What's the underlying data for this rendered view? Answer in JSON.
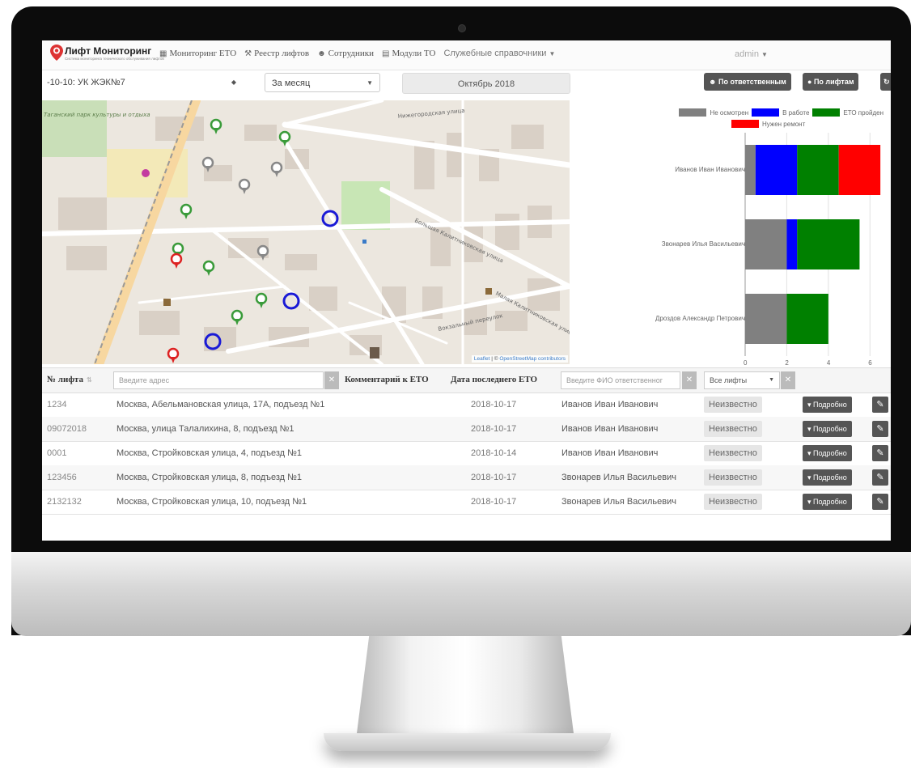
{
  "navbar": {
    "logo_title": "Лифт Мониторинг",
    "logo_subtitle": "Система мониторинга технического обслуживания лифтов",
    "items": [
      {
        "icon": "building-icon",
        "label": "Мониторинг ЕТО"
      },
      {
        "icon": "gavel-icon",
        "label": "Реестр лифтов"
      },
      {
        "icon": "users-icon",
        "label": "Сотрудники"
      },
      {
        "icon": "trash-icon",
        "label": "Модули ТО"
      },
      {
        "icon": "",
        "label": "Служебные справочники",
        "dropdown": true
      }
    ],
    "user": "admin"
  },
  "filters": {
    "organization": "-10-10: УК ЖЭК№7",
    "period": "За месяц",
    "month": "Октябрь 2018",
    "btn_by_responsible": "По ответственным",
    "btn_by_lifts": "По лифтам"
  },
  "map": {
    "attribution_leaflet": "Leaflet",
    "attribution_osm": "OpenStreetMap contributors",
    "labels": [
      "Таганский парк культуры и отдыха",
      "Нижегородская улица",
      "Большая Калитниковская улица",
      "Малая Калитниковская улица",
      "Вокзальный переулок"
    ]
  },
  "chart_data": {
    "type": "bar",
    "orientation": "horizontal",
    "stacked": true,
    "categories": [
      "Иванов Иван Иванович",
      "Звонарев Илья Васильевич",
      "Дроздов Александр Петрович"
    ],
    "series": [
      {
        "name": "Не осмотрен",
        "color": "#808080",
        "values": [
          0.5,
          2,
          2
        ]
      },
      {
        "name": "В работе",
        "color": "#0000ff",
        "values": [
          2,
          0.5,
          0
        ]
      },
      {
        "name": "ЕТО пройден",
        "color": "#008000",
        "values": [
          2,
          3,
          2
        ]
      },
      {
        "name": "Нужен ремонт",
        "color": "#ff0000",
        "values": [
          2,
          0,
          0
        ]
      }
    ],
    "xlim": [
      0,
      7
    ],
    "xticks": [
      "0",
      "2",
      "4",
      "6"
    ],
    "legend_position": "top-right"
  },
  "table": {
    "headers": {
      "lift_no": "№ лифта",
      "address_placeholder": "Введите адрес",
      "comment": "Комментарий к ЕТО",
      "last_date": "Дата последнего ЕТО",
      "responsible_placeholder": "Введите ФИО ответственног",
      "lift_filter": "Все лифты"
    },
    "rows": [
      {
        "num": "1234",
        "address": "Москва, Абельмановская улица, 17А, подъезд №1",
        "date": "2018-10-17",
        "person": "Иванов Иван Иванович",
        "status": "Неизвестно"
      },
      {
        "num": "09072018",
        "address": "Москва, улица Талалихина, 8, подъезд №1",
        "date": "2018-10-17",
        "person": "Иванов Иван Иванович",
        "status": "Неизвестно"
      },
      {
        "num": "0001",
        "address": "Москва, Стройковская улица, 4, подъезд №1",
        "date": "2018-10-14",
        "person": "Иванов Иван Иванович",
        "status": "Неизвестно"
      },
      {
        "num": "123456",
        "address": "Москва, Стройковская улица, 8, подъезд №1",
        "date": "2018-10-17",
        "person": "Звонарев Илья Васильевич",
        "status": "Неизвестно"
      },
      {
        "num": "2132132",
        "address": "Москва, Стройковская улица, 10, подъезд №1",
        "date": "2018-10-17",
        "person": "Звонарев Илья Васильевич",
        "status": "Неизвестно"
      }
    ],
    "more_label": "Подробно"
  }
}
